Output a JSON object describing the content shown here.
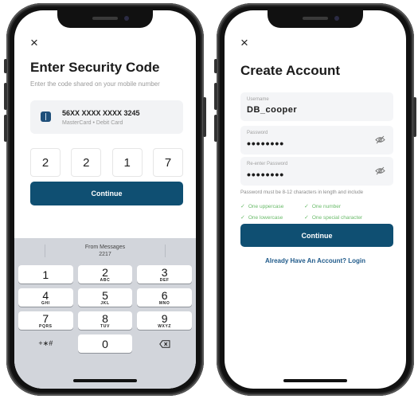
{
  "left_screen": {
    "close": "×",
    "title": "Enter Security Code",
    "subtitle": "Enter the code shared on your mobile number",
    "card": {
      "number": "56XX XXXX XXXX 3245",
      "type": "MasterCard • Debit Card",
      "icon": "card-icon"
    },
    "otp_digits": [
      "2",
      "2",
      "1",
      "7"
    ],
    "continue_label": "Continue",
    "keyboard": {
      "suggestion_line1": "From Messages",
      "suggestion_line2": "2217",
      "keys": [
        {
          "num": "1",
          "letters": ""
        },
        {
          "num": "2",
          "letters": "ABC"
        },
        {
          "num": "3",
          "letters": "DEF"
        },
        {
          "num": "4",
          "letters": "GHI"
        },
        {
          "num": "5",
          "letters": "JKL"
        },
        {
          "num": "6",
          "letters": "MNO"
        },
        {
          "num": "7",
          "letters": "PQRS"
        },
        {
          "num": "8",
          "letters": "TUV"
        },
        {
          "num": "9",
          "letters": "WXYZ"
        }
      ],
      "symbols_key": "+∗#",
      "zero_key": "0",
      "delete_icon": "backspace-icon"
    }
  },
  "right_screen": {
    "close": "×",
    "title": "Create Account",
    "username": {
      "label": "Username",
      "value": "DB_cooper"
    },
    "password": {
      "label": "Password",
      "value": "••••••••"
    },
    "reenter_password": {
      "label": "Re-enter Password",
      "value": "••••••••"
    },
    "password_rule": "Password must be 8-12 characters in length and include",
    "checks": [
      "One uppercase",
      "One number",
      "One lowercase",
      "One special character"
    ],
    "continue_label": "Continue",
    "login_link": "Already Have An Account? Login"
  },
  "colors": {
    "primary": "#0f4f72",
    "check_green": "#6abb6a",
    "link": "#1f5a8a",
    "keyboard_bg": "#d2d5db"
  }
}
